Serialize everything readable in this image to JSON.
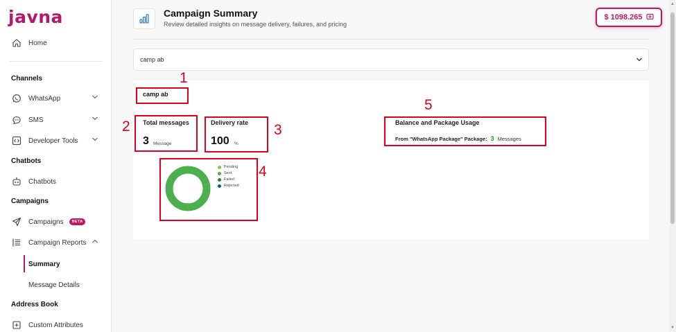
{
  "brand": {
    "logo": "javna"
  },
  "sidebar": {
    "home": "Home",
    "channels_heading": "Channels",
    "whatsapp": "WhatsApp",
    "sms": "SMS",
    "developer_tools": "Developer Tools",
    "chatbots_heading": "Chatbots",
    "chatbots": "Chatbots",
    "campaigns_heading": "Campaigns",
    "campaigns": "Campaigns",
    "beta_badge": "BETA",
    "campaign_reports": "Campaign Reports",
    "summary": "Summary",
    "message_details": "Message Details",
    "address_book_heading": "Address Book",
    "custom_attributes": "Custom Attributes"
  },
  "header": {
    "title": "Campaign Summary",
    "subtitle": "Review detailed insights on message delivery, failures, and pricing",
    "balance": "$ 1098.265"
  },
  "campaign_select": {
    "value": "camp ab"
  },
  "summary": {
    "campaign_name": "camp ab",
    "total_messages_label": "Total messages",
    "total_messages_value": "3",
    "total_messages_unit": "Message",
    "delivery_rate_label": "Delivery rate",
    "delivery_rate_value": "100",
    "delivery_rate_unit": "%"
  },
  "donut": {
    "legend": [
      {
        "label": "Pending",
        "color": "#8bc34a"
      },
      {
        "label": "Sent",
        "color": "#4caf50"
      },
      {
        "label": "Failed",
        "color": "#2e7d32"
      },
      {
        "label": "Rejected",
        "color": "#00695c"
      }
    ],
    "ring_color": "#4caf50"
  },
  "balance_usage": {
    "title": "Balance and Package Usage",
    "from_label": "From \"WhatsApp Package\" Package:",
    "count": "3",
    "unit": "Messages"
  },
  "annotations": [
    "1",
    "2",
    "3",
    "4",
    "5"
  ],
  "colors": {
    "brand": "#b5176b",
    "annotation": "#e0001b"
  }
}
